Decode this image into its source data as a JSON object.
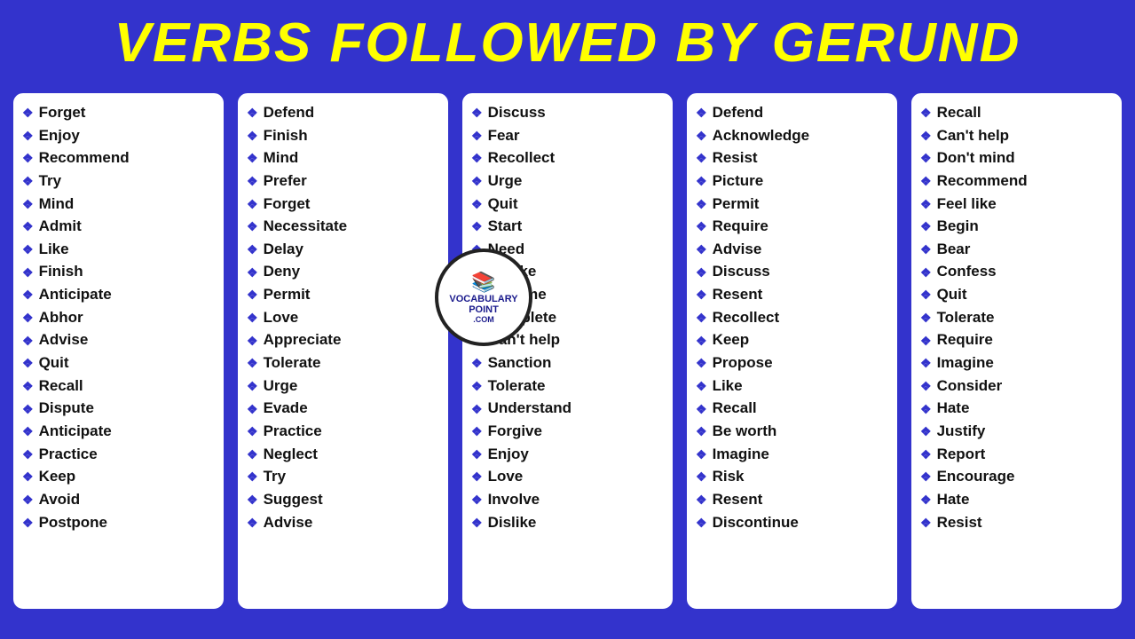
{
  "header": {
    "title": "VERBS FOLLOWED BY GERUND"
  },
  "columns": [
    {
      "id": "col1",
      "items": [
        "Forget",
        "Enjoy",
        "Recommend",
        "Try",
        "Mind",
        "Admit",
        "Like",
        "Finish",
        "Anticipate",
        "Abhor",
        "Advise",
        "Quit",
        "Recall",
        "Dispute",
        "Anticipate",
        "Practice",
        "Keep",
        "Avoid",
        "Postpone"
      ]
    },
    {
      "id": "col2",
      "items": [
        "Defend",
        "Finish",
        "Mind",
        "Prefer",
        "Forget",
        "Necessitate",
        "Delay",
        "Deny",
        "Permit",
        "Love",
        "Appreciate",
        "Tolerate",
        "Urge",
        "Evade",
        "Practice",
        "Neglect",
        "Try",
        "Suggest",
        "Advise"
      ]
    },
    {
      "id": "col3",
      "items": [
        "Discuss",
        "Fear",
        "Recollect",
        "Urge",
        "Quit",
        "Start",
        "Need",
        "Dislike",
        "Resume",
        "Complete",
        "Can't help",
        "Sanction",
        "Tolerate",
        "Understand",
        "Forgive",
        "Enjoy",
        "Love",
        "Involve",
        "Dislike"
      ]
    },
    {
      "id": "col4",
      "items": [
        "Defend",
        "Acknowledge",
        "Resist",
        "Picture",
        "Permit",
        "Require",
        "Advise",
        "Discuss",
        "Resent",
        "Recollect",
        "Keep",
        "Propose",
        "Like",
        "Recall",
        "Be worth",
        "Imagine",
        "Risk",
        "Resent",
        "Discontinue"
      ]
    },
    {
      "id": "col5",
      "items": [
        "Recall",
        "Can't help",
        "Don't mind",
        "Recommend",
        "Feel like",
        "Begin",
        "Bear",
        "Confess",
        "Quit",
        "Tolerate",
        "Require",
        "Imagine",
        "Consider",
        "Hate",
        "Justify",
        "Report",
        "Encourage",
        "Hate",
        "Resist"
      ]
    }
  ],
  "logo": {
    "line1": "VOCABULARY",
    "line2": "POINT",
    "line3": ".COM"
  }
}
